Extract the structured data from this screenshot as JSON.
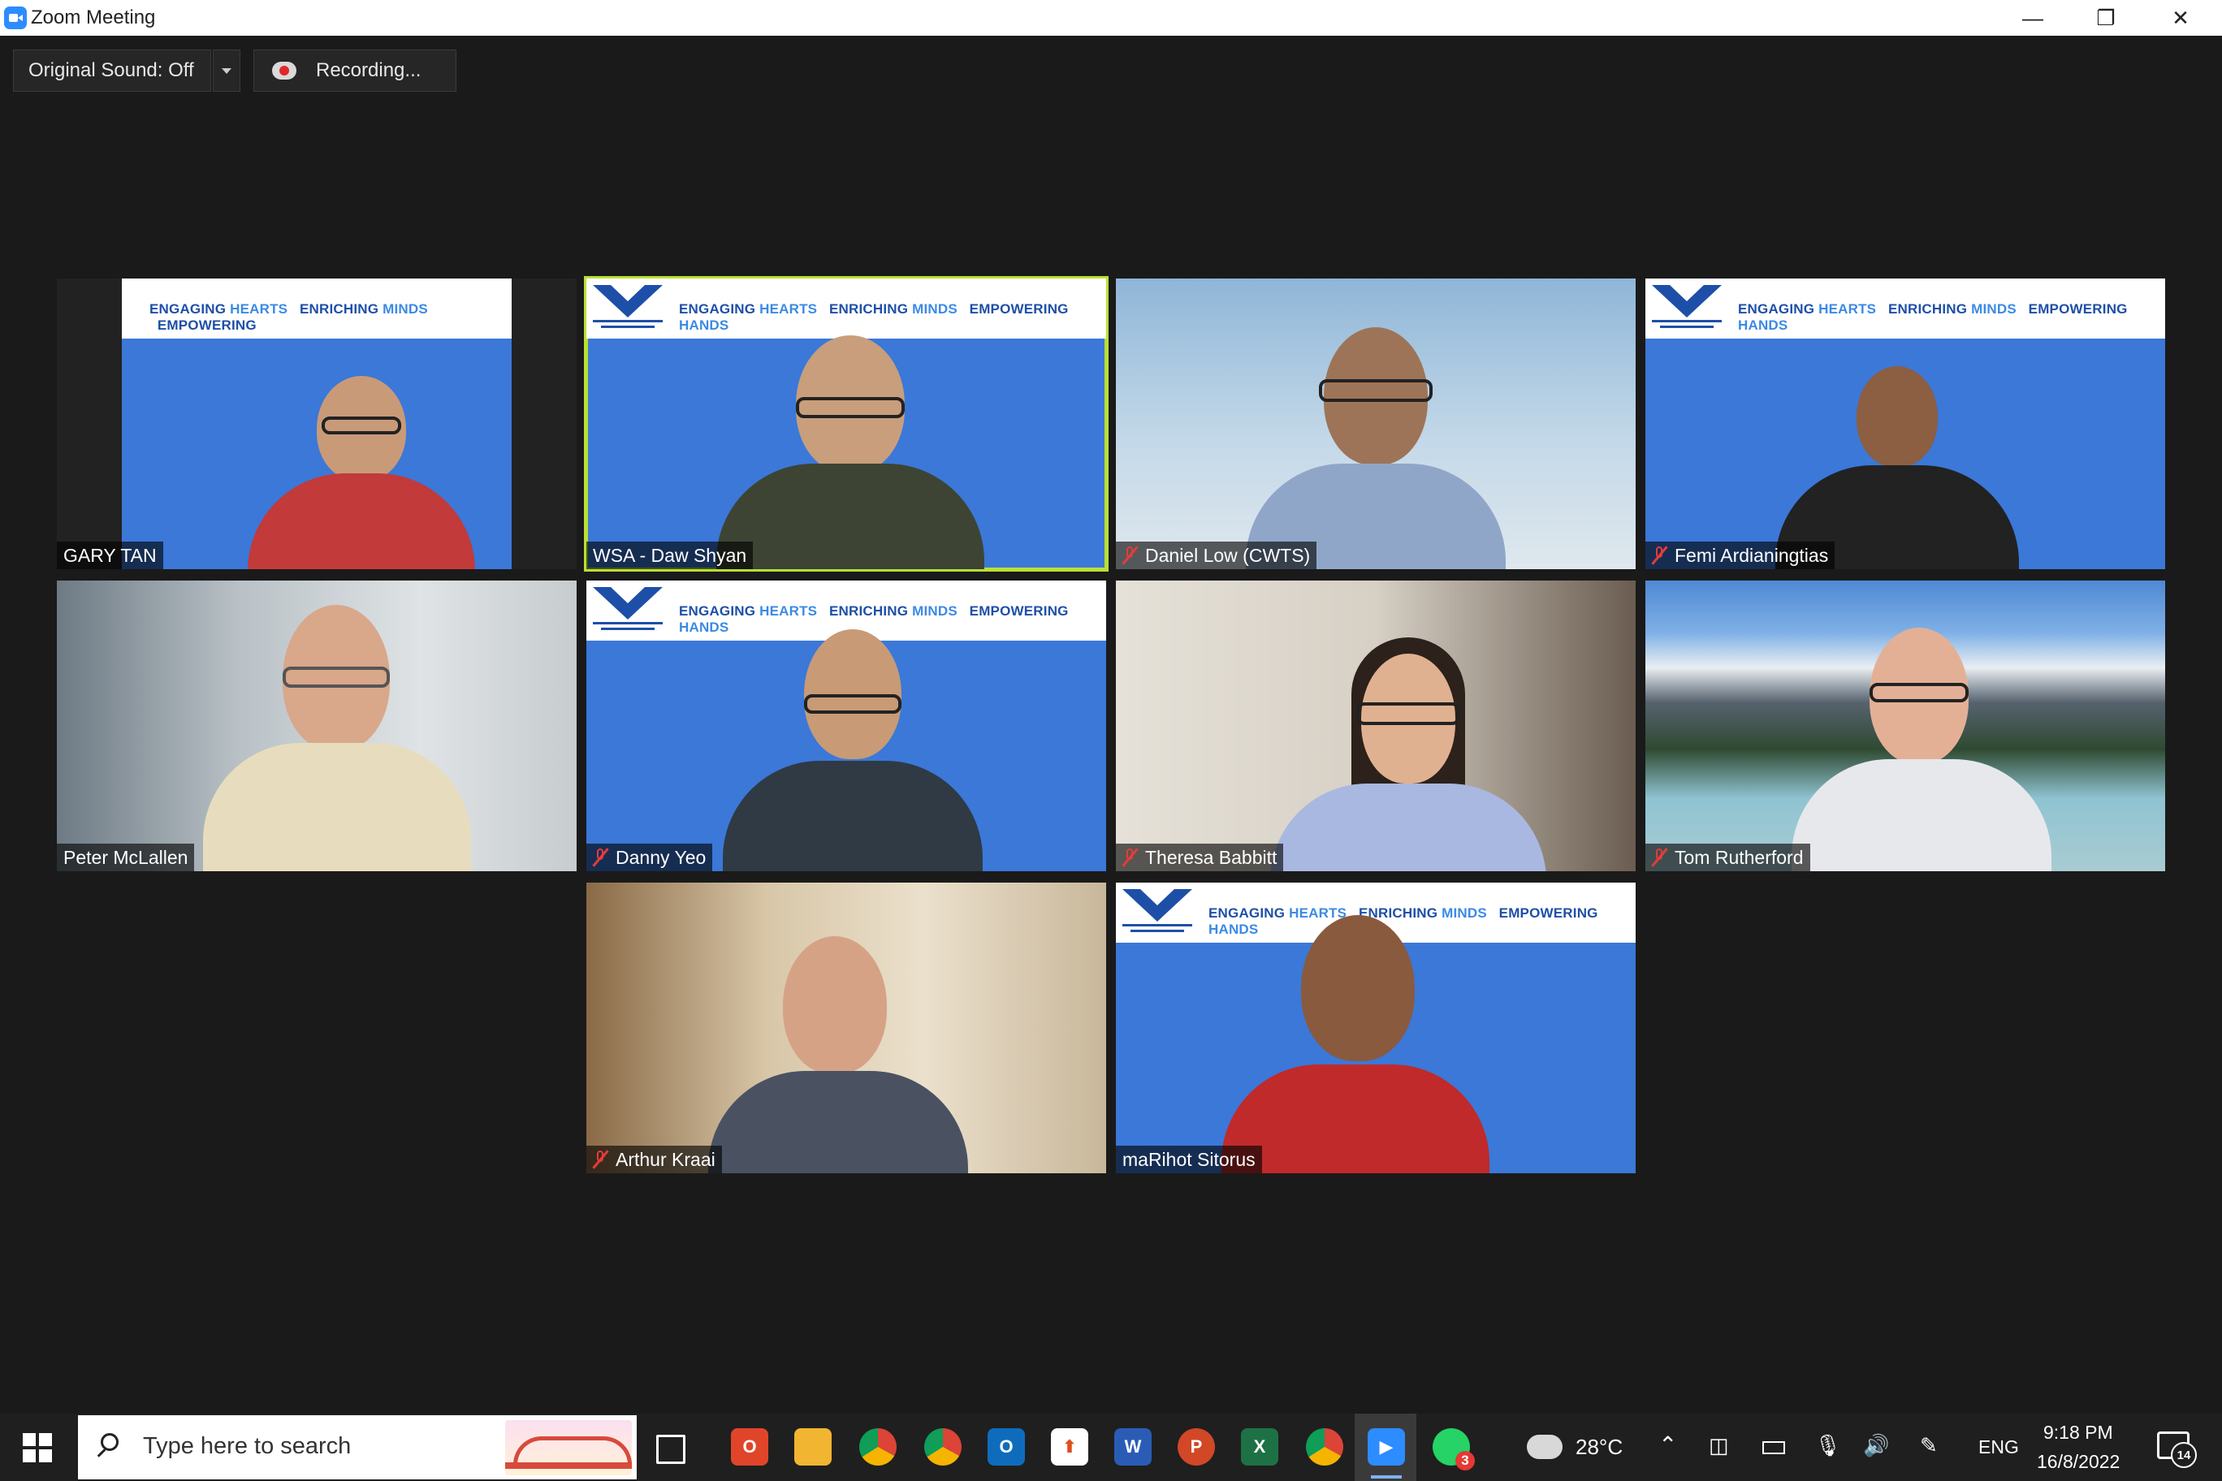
{
  "window": {
    "title": "Zoom Meeting",
    "minimize_glyph": "—",
    "restore_glyph": "❐",
    "close_glyph": "✕"
  },
  "controls": {
    "original_sound": "Original Sound: Off",
    "recording": "Recording..."
  },
  "banner": {
    "slogan_1a": "ENGAGING ",
    "slogan_1b": "HEARTS",
    "slogan_2a": "ENRICHING ",
    "slogan_2b": "MINDS",
    "slogan_3a": "EMPOWERING ",
    "slogan_3b": "HANDS"
  },
  "participants": [
    {
      "name": "GARY TAN",
      "muted": false,
      "active_speaker": false
    },
    {
      "name": "WSA - Daw Shyan",
      "muted": false,
      "active_speaker": true
    },
    {
      "name": "Daniel Low (CWTS)",
      "muted": true,
      "active_speaker": false
    },
    {
      "name": "Femi Ardianingtias",
      "muted": true,
      "active_speaker": false
    },
    {
      "name": "Peter McLallen",
      "muted": false,
      "active_speaker": false
    },
    {
      "name": "Danny Yeo",
      "muted": true,
      "active_speaker": false
    },
    {
      "name": "Theresa Babbitt",
      "muted": true,
      "active_speaker": false
    },
    {
      "name": "Tom Rutherford",
      "muted": true,
      "active_speaker": false
    },
    {
      "name": "Arthur Kraai",
      "muted": true,
      "active_speaker": false
    },
    {
      "name": "maRihot Sitorus",
      "muted": false,
      "active_speaker": false
    }
  ],
  "taskbar": {
    "search_placeholder": "Type here to search",
    "temperature": "28°C",
    "language": "ENG",
    "time": "9:18 PM",
    "date": "16/8/2022",
    "whatsapp_badge": "3",
    "notification_count": "14"
  },
  "colors": {
    "accent_speaker": "#b9e033",
    "banner_blue": "#1e4fa8",
    "tile_blue": "#3b78d8",
    "muted_red": "#e53b3b"
  }
}
